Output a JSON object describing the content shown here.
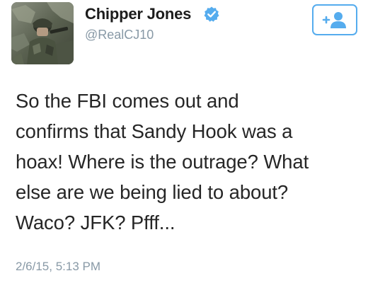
{
  "tweet": {
    "display_name": "Chipper Jones",
    "handle": "@RealCJ10",
    "verified": true,
    "text": "So the FBI comes out and\nconfirms that Sandy Hook was a\nhoax! Where is the outrage? What\nelse are we being lied to about?\nWaco? JFK? Pfff...",
    "timestamp": "2/6/15, 5:13 PM"
  },
  "icons": {
    "avatar": "avatar-photo",
    "verified": "verified-badge-icon",
    "follow": "follow-add-user-icon"
  },
  "colors": {
    "accent": "#55acee",
    "secondary_text": "#8899a6",
    "primary_text": "#1c1c1c"
  }
}
